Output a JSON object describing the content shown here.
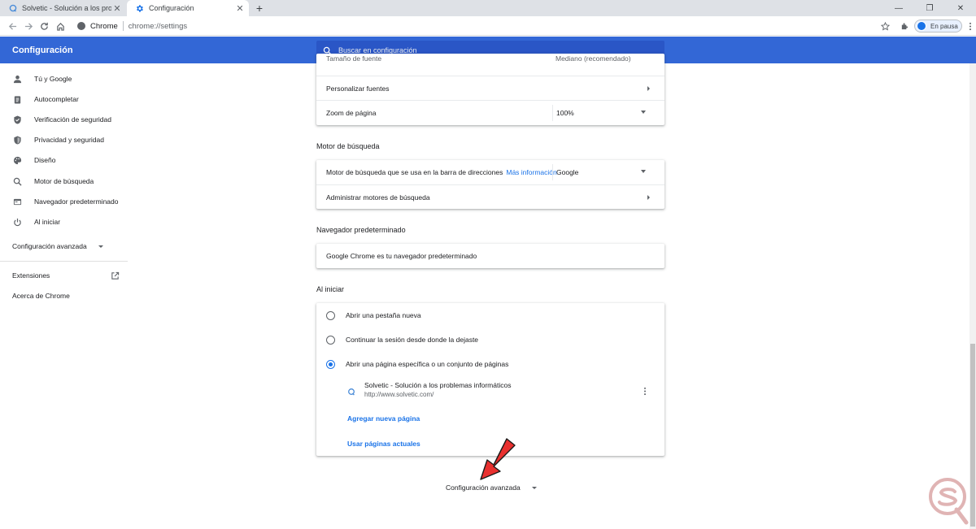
{
  "browser": {
    "tabs": [
      {
        "title": "Solvetic - Solución a los problemas",
        "active": false
      },
      {
        "title": "Configuración",
        "active": true
      }
    ],
    "omnibox_label": "Chrome",
    "url": "chrome://settings",
    "profile_label": "En pausa"
  },
  "header": {
    "title": "Configuración",
    "search_placeholder": "Buscar en configuración"
  },
  "sidebar": {
    "items": [
      {
        "label": "Tú y Google",
        "icon": "person-icon"
      },
      {
        "label": "Autocompletar",
        "icon": "clipboard-icon"
      },
      {
        "label": "Verificación de seguridad",
        "icon": "shield-check-icon"
      },
      {
        "label": "Privacidad y seguridad",
        "icon": "shield-icon"
      },
      {
        "label": "Diseño",
        "icon": "palette-icon"
      },
      {
        "label": "Motor de búsqueda",
        "icon": "search-icon"
      },
      {
        "label": "Navegador predeterminado",
        "icon": "browser-icon"
      },
      {
        "label": "Al iniciar",
        "icon": "power-icon"
      }
    ],
    "advanced_label": "Configuración avanzada",
    "extensions_label": "Extensiones",
    "about_label": "Acerca de Chrome"
  },
  "appearance": {
    "clipped_label": "Tamaño de fuente",
    "clipped_value": "Mediano (recomendado)",
    "customize_fonts": "Personalizar fuentes",
    "zoom_label": "Zoom de página",
    "zoom_value": "100%"
  },
  "search_engine": {
    "section_title": "Motor de búsqueda",
    "engine_label": "Motor de búsqueda que se usa en la barra de direcciones",
    "more_info": "Más información",
    "engine_value": "Google",
    "manage_label": "Administrar motores de búsqueda"
  },
  "default_browser": {
    "section_title": "Navegador predeterminado",
    "status": "Google Chrome es tu navegador predeterminado"
  },
  "startup": {
    "section_title": "Al iniciar",
    "options": [
      {
        "label": "Abrir una pestaña nueva",
        "checked": false
      },
      {
        "label": "Continuar la sesión desde donde la dejaste",
        "checked": false
      },
      {
        "label": "Abrir una página específica o un conjunto de páginas",
        "checked": true
      }
    ],
    "page": {
      "title": "Solvetic - Solución a los problemas informáticos",
      "url": "http://www.solvetic.com/"
    },
    "add_page": "Agregar nueva página",
    "use_current": "Usar páginas actuales"
  },
  "footer": {
    "advanced_label": "Configuración avanzada"
  },
  "colors": {
    "header": "#3367d6",
    "link": "#1a73e8",
    "arrow": "#e8302f"
  }
}
